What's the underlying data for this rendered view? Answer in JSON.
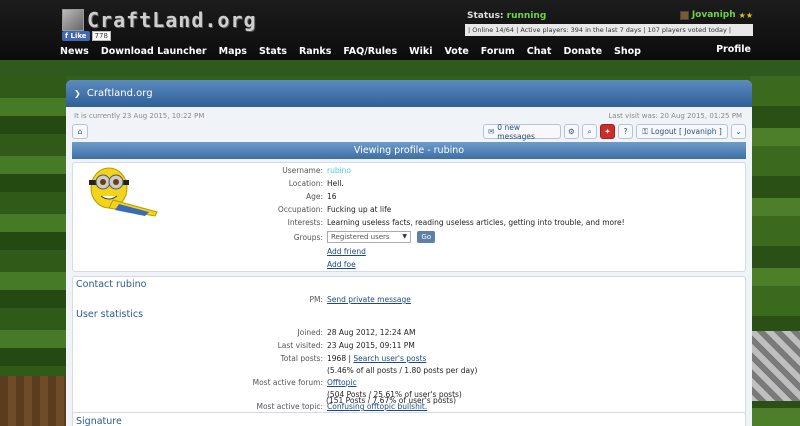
{
  "header": {
    "logo_text": "CraftLand.org",
    "fb_like": "Like",
    "fb_count": "778",
    "status_label": "Status:",
    "status_value": "running",
    "username": "Jovaniph",
    "stars": "★★",
    "online_strip": "| Online 14/64 | Active players: 394 in the last 7 days | 107 players voted today |"
  },
  "nav": {
    "items": [
      "News",
      "Download Launcher",
      "Maps",
      "Stats",
      "Ranks",
      "FAQ/Rules",
      "Wiki",
      "Vote",
      "Forum",
      "Chat",
      "Donate",
      "Shop"
    ],
    "profile": "Profile"
  },
  "panel": {
    "site": "Craftland.org",
    "current_time": "It is currently 23 Aug 2015, 10:22 PM",
    "last_visit": "Last visit was: 20 Aug 2015, 01:25 PM",
    "toolbar": {
      "messages": "0 new messages",
      "logout": "Logout [ Jovaniph ]"
    },
    "view_title": "Viewing profile - rubino"
  },
  "profile": {
    "username_label": "Username:",
    "username_value": "rubino",
    "location_label": "Location:",
    "location_value": "Hell.",
    "age_label": "Age:",
    "age_value": "16",
    "occupation_label": "Occupation:",
    "occupation_value": "Fucking up at life",
    "interests_label": "Interests:",
    "interests_value": "Learning useless facts, reading useless articles, getting into trouble, and more!",
    "groups_label": "Groups:",
    "groups_selected": "Registered users",
    "go_label": "Go",
    "add_friend": "Add friend",
    "add_foe": "Add foe"
  },
  "contact": {
    "title": "Contact rubino",
    "pm_label": "PM:",
    "pm_link": "Send private message"
  },
  "stats": {
    "title": "User statistics",
    "joined_label": "Joined:",
    "joined_value": "28 Aug 2012, 12:24 AM",
    "lastvisited_label": "Last visited:",
    "lastvisited_value": "23 Aug 2015, 09:11 PM",
    "totalposts_label": "Total posts:",
    "totalposts_value": "1968 |",
    "search_posts": "Search user's posts",
    "totalposts_detail": "(5.46% of all posts / 1.80 posts per day)",
    "activeforum_label": "Most active forum:",
    "activeforum_value": "Offtopic",
    "activeforum_detail": "(504 Posts / 25.61% of user's posts)",
    "activetopic_label": "Most active topic:",
    "activetopic_value": "Confusing offtopic bullshit.",
    "activetopic_detail": "(151 Posts / 7.67% of user's posts)"
  },
  "signature": {
    "title": "Signature"
  }
}
